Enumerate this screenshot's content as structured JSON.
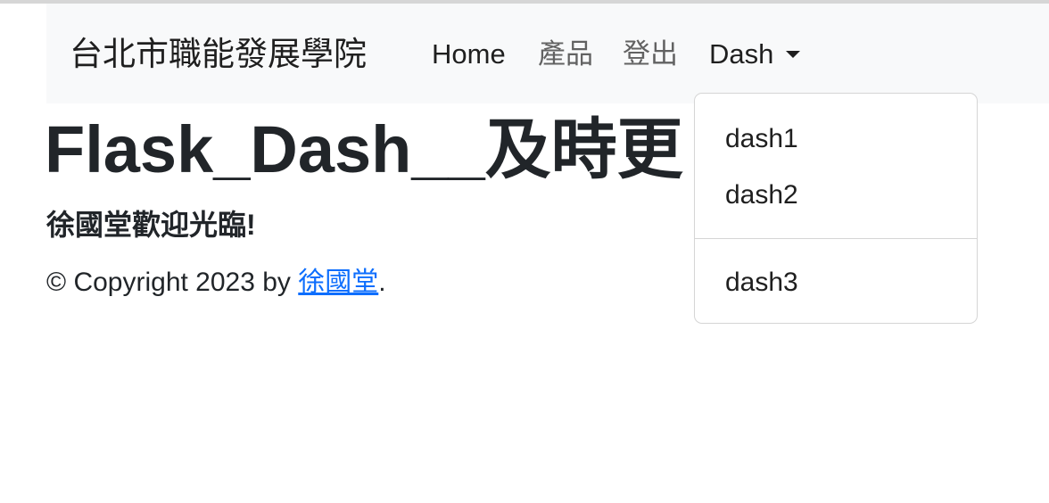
{
  "navbar": {
    "brand": "台北市職能發展學院",
    "links": {
      "home": "Home",
      "products": "產品",
      "logout": "登出",
      "dash": "Dash"
    }
  },
  "dropdown": {
    "items": [
      "dash1",
      "dash2",
      "dash3"
    ]
  },
  "main": {
    "title": "Flask_Dash__及時更",
    "welcome": "徐國堂歡迎光臨!",
    "copyright_prefix": "© Copyright 2023 by ",
    "author_link": "徐國堂",
    "copyright_suffix": "."
  },
  "colors": {
    "navbar_bg": "#f8f9fa",
    "link": "#0d6efd",
    "text": "#212529",
    "muted_nav": "#626262"
  }
}
